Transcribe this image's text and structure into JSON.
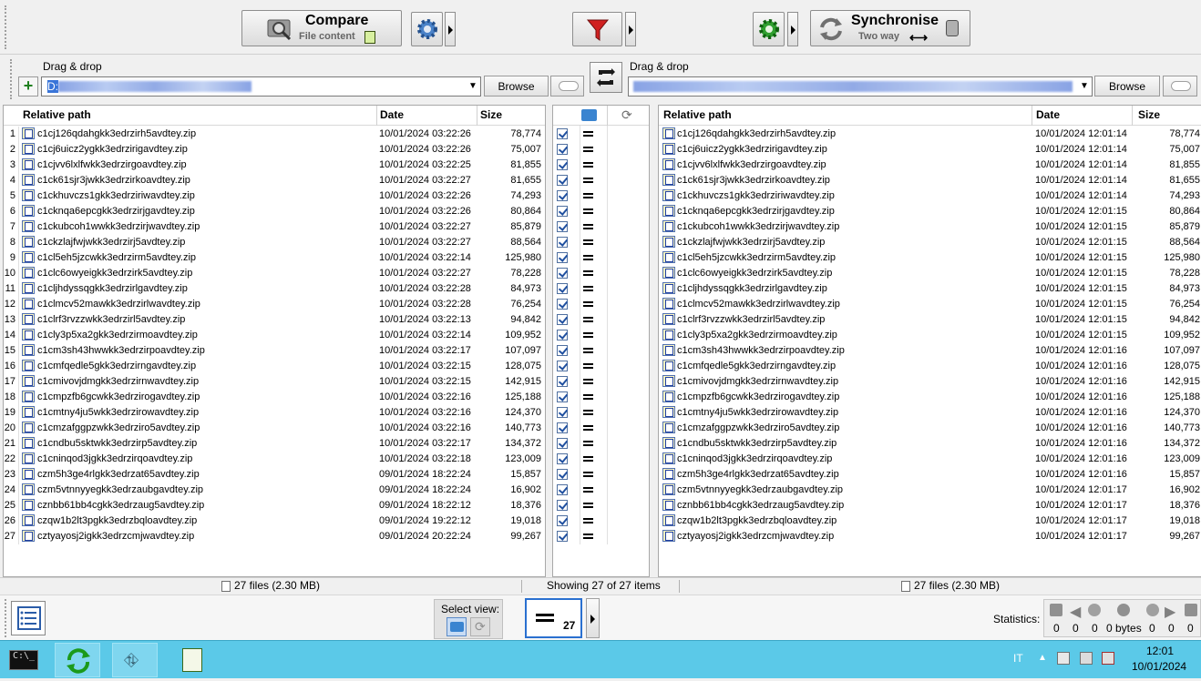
{
  "toolbar": {
    "compare_label": "Compare",
    "compare_sub": "File content",
    "sync_label": "Synchronise",
    "sync_sub": "Two way"
  },
  "left_folder": {
    "drag_label": "Drag & drop",
    "path_prefix": "D:",
    "browse": "Browse"
  },
  "right_folder": {
    "drag_label": "Drag & drop",
    "browse": "Browse"
  },
  "columns": {
    "left": [
      "Relative path",
      "Date",
      "Size"
    ],
    "right": [
      "Relative path",
      "Date",
      "Size"
    ]
  },
  "rows": [
    {
      "n": "1",
      "name": "c1cj126qdahgkk3edrzirh5avdtey.zip",
      "ld": "10/01/2024  03:22:26",
      "size": "78,774",
      "rd": "10/01/2024  12:01:14"
    },
    {
      "n": "2",
      "name": "c1cj6uicz2ygkk3edrzirigavdtey.zip",
      "ld": "10/01/2024  03:22:26",
      "size": "75,007",
      "rd": "10/01/2024  12:01:14"
    },
    {
      "n": "3",
      "name": "c1cjvv6lxlfwkk3edrzirgoavdtey.zip",
      "ld": "10/01/2024  03:22:25",
      "size": "81,855",
      "rd": "10/01/2024  12:01:14"
    },
    {
      "n": "4",
      "name": "c1ck61sjr3jwkk3edrzirkoavdtey.zip",
      "ld": "10/01/2024  03:22:27",
      "size": "81,655",
      "rd": "10/01/2024  12:01:14"
    },
    {
      "n": "5",
      "name": "c1ckhuvczs1gkk3edrziriwavdtey.zip",
      "ld": "10/01/2024  03:22:26",
      "size": "74,293",
      "rd": "10/01/2024  12:01:14"
    },
    {
      "n": "6",
      "name": "c1cknqa6epcgkk3edrzirjgavdtey.zip",
      "ld": "10/01/2024  03:22:26",
      "size": "80,864",
      "rd": "10/01/2024  12:01:15"
    },
    {
      "n": "7",
      "name": "c1ckubcoh1wwkk3edrzirjwavdtey.zip",
      "ld": "10/01/2024  03:22:27",
      "size": "85,879",
      "rd": "10/01/2024  12:01:15"
    },
    {
      "n": "8",
      "name": "c1ckzlajfwjwkk3edrzirj5avdtey.zip",
      "ld": "10/01/2024  03:22:27",
      "size": "88,564",
      "rd": "10/01/2024  12:01:15"
    },
    {
      "n": "9",
      "name": "c1cl5eh5jzcwkk3edrzirm5avdtey.zip",
      "ld": "10/01/2024  03:22:14",
      "size": "125,980",
      "rd": "10/01/2024  12:01:15"
    },
    {
      "n": "10",
      "name": "c1clc6owyeigkk3edrzirk5avdtey.zip",
      "ld": "10/01/2024  03:22:27",
      "size": "78,228",
      "rd": "10/01/2024  12:01:15"
    },
    {
      "n": "11",
      "name": "c1cljhdyssqgkk3edrzirlgavdtey.zip",
      "ld": "10/01/2024  03:22:28",
      "size": "84,973",
      "rd": "10/01/2024  12:01:15"
    },
    {
      "n": "12",
      "name": "c1clmcv52mawkk3edrzirlwavdtey.zip",
      "ld": "10/01/2024  03:22:28",
      "size": "76,254",
      "rd": "10/01/2024  12:01:15"
    },
    {
      "n": "13",
      "name": "c1clrf3rvzzwkk3edrzirl5avdtey.zip",
      "ld": "10/01/2024  03:22:13",
      "size": "94,842",
      "rd": "10/01/2024  12:01:15"
    },
    {
      "n": "14",
      "name": "c1cly3p5xa2gkk3edrzirmoavdtey.zip",
      "ld": "10/01/2024  03:22:14",
      "size": "109,952",
      "rd": "10/01/2024  12:01:15"
    },
    {
      "n": "15",
      "name": "c1cm3sh43hwwkk3edrzirpoavdtey.zip",
      "ld": "10/01/2024  03:22:17",
      "size": "107,097",
      "rd": "10/01/2024  12:01:16"
    },
    {
      "n": "16",
      "name": "c1cmfqedle5gkk3edrzirngavdtey.zip",
      "ld": "10/01/2024  03:22:15",
      "size": "128,075",
      "rd": "10/01/2024  12:01:16"
    },
    {
      "n": "17",
      "name": "c1cmivovjdmgkk3edrzirnwavdtey.zip",
      "ld": "10/01/2024  03:22:15",
      "size": "142,915",
      "rd": "10/01/2024  12:01:16"
    },
    {
      "n": "18",
      "name": "c1cmpzfb6gcwkk3edrzirogavdtey.zip",
      "ld": "10/01/2024  03:22:16",
      "size": "125,188",
      "rd": "10/01/2024  12:01:16"
    },
    {
      "n": "19",
      "name": "c1cmtny4ju5wkk3edrzirowavdtey.zip",
      "ld": "10/01/2024  03:22:16",
      "size": "124,370",
      "rd": "10/01/2024  12:01:16"
    },
    {
      "n": "20",
      "name": "c1cmzafggpzwkk3edrziro5avdtey.zip",
      "ld": "10/01/2024  03:22:16",
      "size": "140,773",
      "rd": "10/01/2024  12:01:16"
    },
    {
      "n": "21",
      "name": "c1cndbu5sktwkk3edrzirp5avdtey.zip",
      "ld": "10/01/2024  03:22:17",
      "size": "134,372",
      "rd": "10/01/2024  12:01:16"
    },
    {
      "n": "22",
      "name": "c1cninqod3jgkk3edrzirqoavdtey.zip",
      "ld": "10/01/2024  03:22:18",
      "size": "123,009",
      "rd": "10/01/2024  12:01:16"
    },
    {
      "n": "23",
      "name": "czm5h3ge4rlgkk3edrzat65avdtey.zip",
      "ld": "09/01/2024  18:22:24",
      "size": "15,857",
      "rd": "10/01/2024  12:01:16"
    },
    {
      "n": "24",
      "name": "czm5vtnnyyegkk3edrzaubgavdtey.zip",
      "ld": "09/01/2024  18:22:24",
      "size": "16,902",
      "rd": "10/01/2024  12:01:17"
    },
    {
      "n": "25",
      "name": "cznbb61bb4cgkk3edrzaug5avdtey.zip",
      "ld": "09/01/2024  18:22:12",
      "size": "18,376",
      "rd": "10/01/2024  12:01:17"
    },
    {
      "n": "26",
      "name": "czqw1b2lt3pgkk3edrzbqloavdtey.zip",
      "ld": "09/01/2024  19:22:12",
      "size": "19,018",
      "rd": "10/01/2024  12:01:17"
    },
    {
      "n": "27",
      "name": "cztyayosj2igkk3edrzcmjwavdtey.zip",
      "ld": "09/01/2024  20:22:24",
      "size": "99,267",
      "rd": "10/01/2024  12:01:17"
    }
  ],
  "status": {
    "left": "27 files  (2.30 MB)",
    "center": "Showing 27 of 27 items",
    "right": "27 files  (2.30 MB)"
  },
  "bottom": {
    "select_view": "Select view:",
    "equal_count": "27",
    "statistics": "Statistics:",
    "stats": [
      "0",
      "0",
      "0",
      "0 bytes",
      "0",
      "0",
      "0"
    ]
  },
  "taskbar": {
    "lang": "IT",
    "time": "12:01",
    "date": "10/01/2024"
  }
}
